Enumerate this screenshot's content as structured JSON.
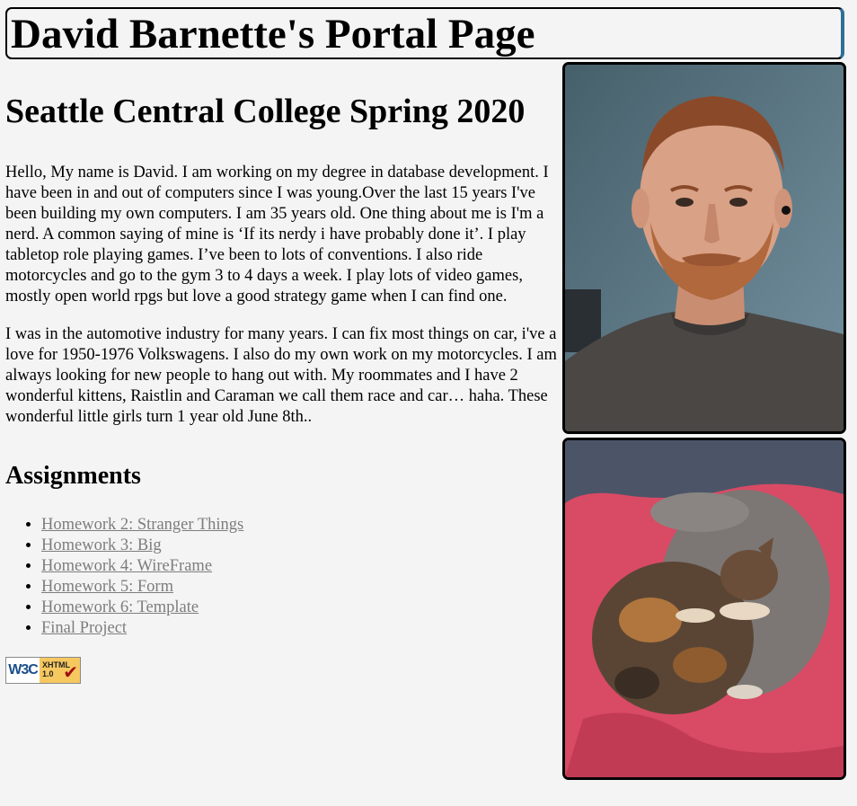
{
  "header": {
    "title": "David Barnette's Portal Page"
  },
  "main": {
    "subtitle": "Seattle Central College Spring 2020",
    "bio_paragraph_1": "Hello, My name is David. I am working on my degree in database development. I have been in and out of computers since I was young.Over the last 15 years I've been building my own computers. I am 35 years old. One thing about me is I'm a nerd. A common saying of mine is ‘If its nerdy i have probably done it’. I play tabletop role playing games. I’ve been to lots of conventions. I also ride motorcycles and go to the gym 3 to 4 days a week. I play lots of video games, mostly open world rpgs but love a good strategy game when I can find one.",
    "bio_paragraph_2": "I was in the automotive industry for many years. I can fix most things on car, i've a love for 1950-1976 Volkswagens. I also do my own work on my motorcycles. I am always looking for new people to hang out with. My roommates and I have 2 wonderful kittens, Raistlin and Caraman we call them race and car… haha. These wonderful little girls turn 1 year old June 8th..",
    "assignments_heading": "Assignments",
    "assignments": [
      {
        "label": "Homework 2: Stranger Things"
      },
      {
        "label": "Homework 3: Big"
      },
      {
        "label": "Homework 4: WireFrame"
      },
      {
        "label": "Homework 5: Form"
      },
      {
        "label": "Homework 6: Template"
      },
      {
        "label": "Final Project"
      }
    ],
    "badge": {
      "org": "W3C",
      "spec": "XHTML",
      "version": "1.0",
      "icon": "checkmark-icon"
    }
  },
  "photos": {
    "portrait_icon": "portrait-photo",
    "cats_icon": "cats-photo"
  },
  "colors": {
    "background": "#f4f4f4",
    "link": "#7d7d7d",
    "banner_accent": "#2f6f9a"
  }
}
